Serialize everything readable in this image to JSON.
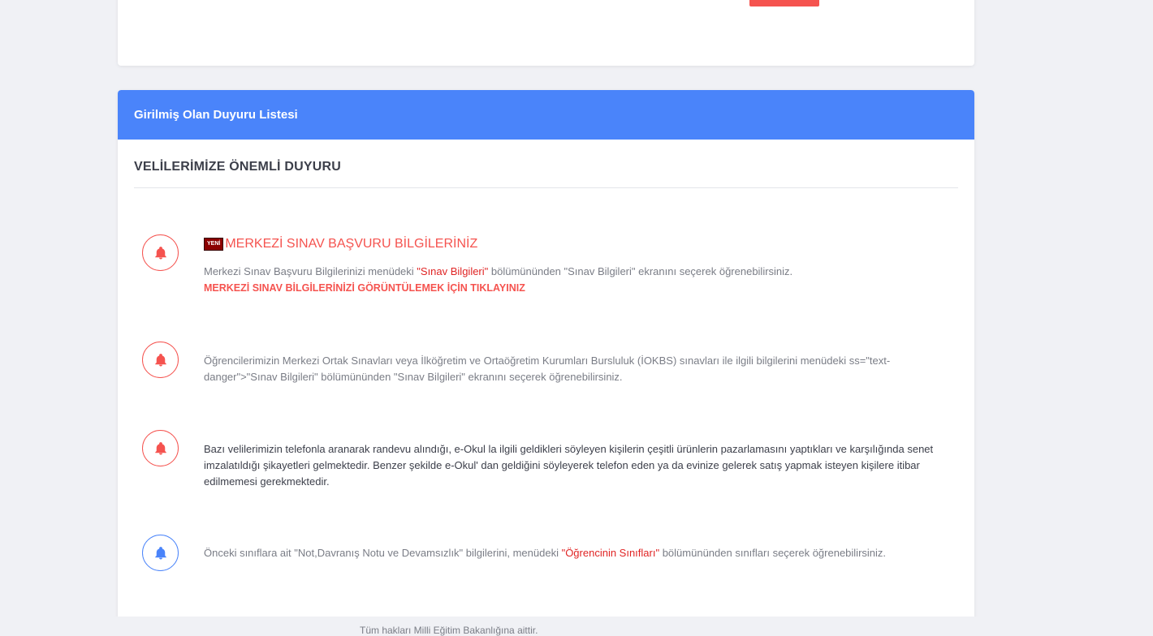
{
  "card": {
    "header_title": "Girilmiş Olan Duyuru Listesi",
    "section_title": "VELİLERİMİZE ÖNEMLİ DUYURU"
  },
  "notices": [
    {
      "badge": "YENİ",
      "title": "MERKEZİ SINAV BAŞVURU BİLGİLERİNİZ",
      "text_before": "Merkezi Sınav Başvuru Bilgilerinizi menüdeki ",
      "text_highlight": "\"Sınav Bilgileri\"",
      "text_after": " bölümününden \"Sınav Bilgileri\" ekranını seçerek öğrenebilirsiniz.",
      "link": "MERKEZİ SINAV BİLGİLERİNİZİ GÖRÜNTÜLEMEK İÇİN TIKLAYINIZ",
      "icon": "bell-icon",
      "color": "#f5534f"
    },
    {
      "text": "Öğrencilerimizin Merkezi Ortak Sınavları veya İlköğretim ve Ortaöğretim Kurumları Bursluluk (İOKBS) sınavları ile ilgili bilgilerini menüdeki ss=\"text-danger\">\"Sınav Bilgileri\" bölümününden \"Sınav Bilgileri\" ekranını seçerek öğrenebilirsiniz.",
      "icon": "bell-icon",
      "color": "#f5534f"
    },
    {
      "text": "Bazı velilerimizin telefonla aranarak randevu alındığı, e-Okul la ilgili geldikleri söyleyen kişilerin çeşitli ürünlerin pazarlamasını yaptıkları ve karşılığında senet imzalatıldığı şikayetleri gelmektedir. Benzer şekilde e-Okul' dan geldiğini söyleyerek telefon eden ya da evinize gelerek satış yapmak isteyen kişilere itibar edilmemesi gerekmektedir.",
      "icon": "bell-icon",
      "color": "#f5534f"
    },
    {
      "text_before": "Önceki sınıflara ait \"Not,Davranış Notu ve Devamsızlık\" bilgilerini, menüdeki ",
      "text_highlight": "\"Öğrencinin Sınıfları\"",
      "text_after": " bölümününden sınıfları seçerek öğrenebilirsiniz.",
      "icon": "bell-icon",
      "color": "#4a84fa"
    }
  ],
  "footer": {
    "text": "Tüm hakları Milli Eğitim Bakanlığına aittir."
  }
}
